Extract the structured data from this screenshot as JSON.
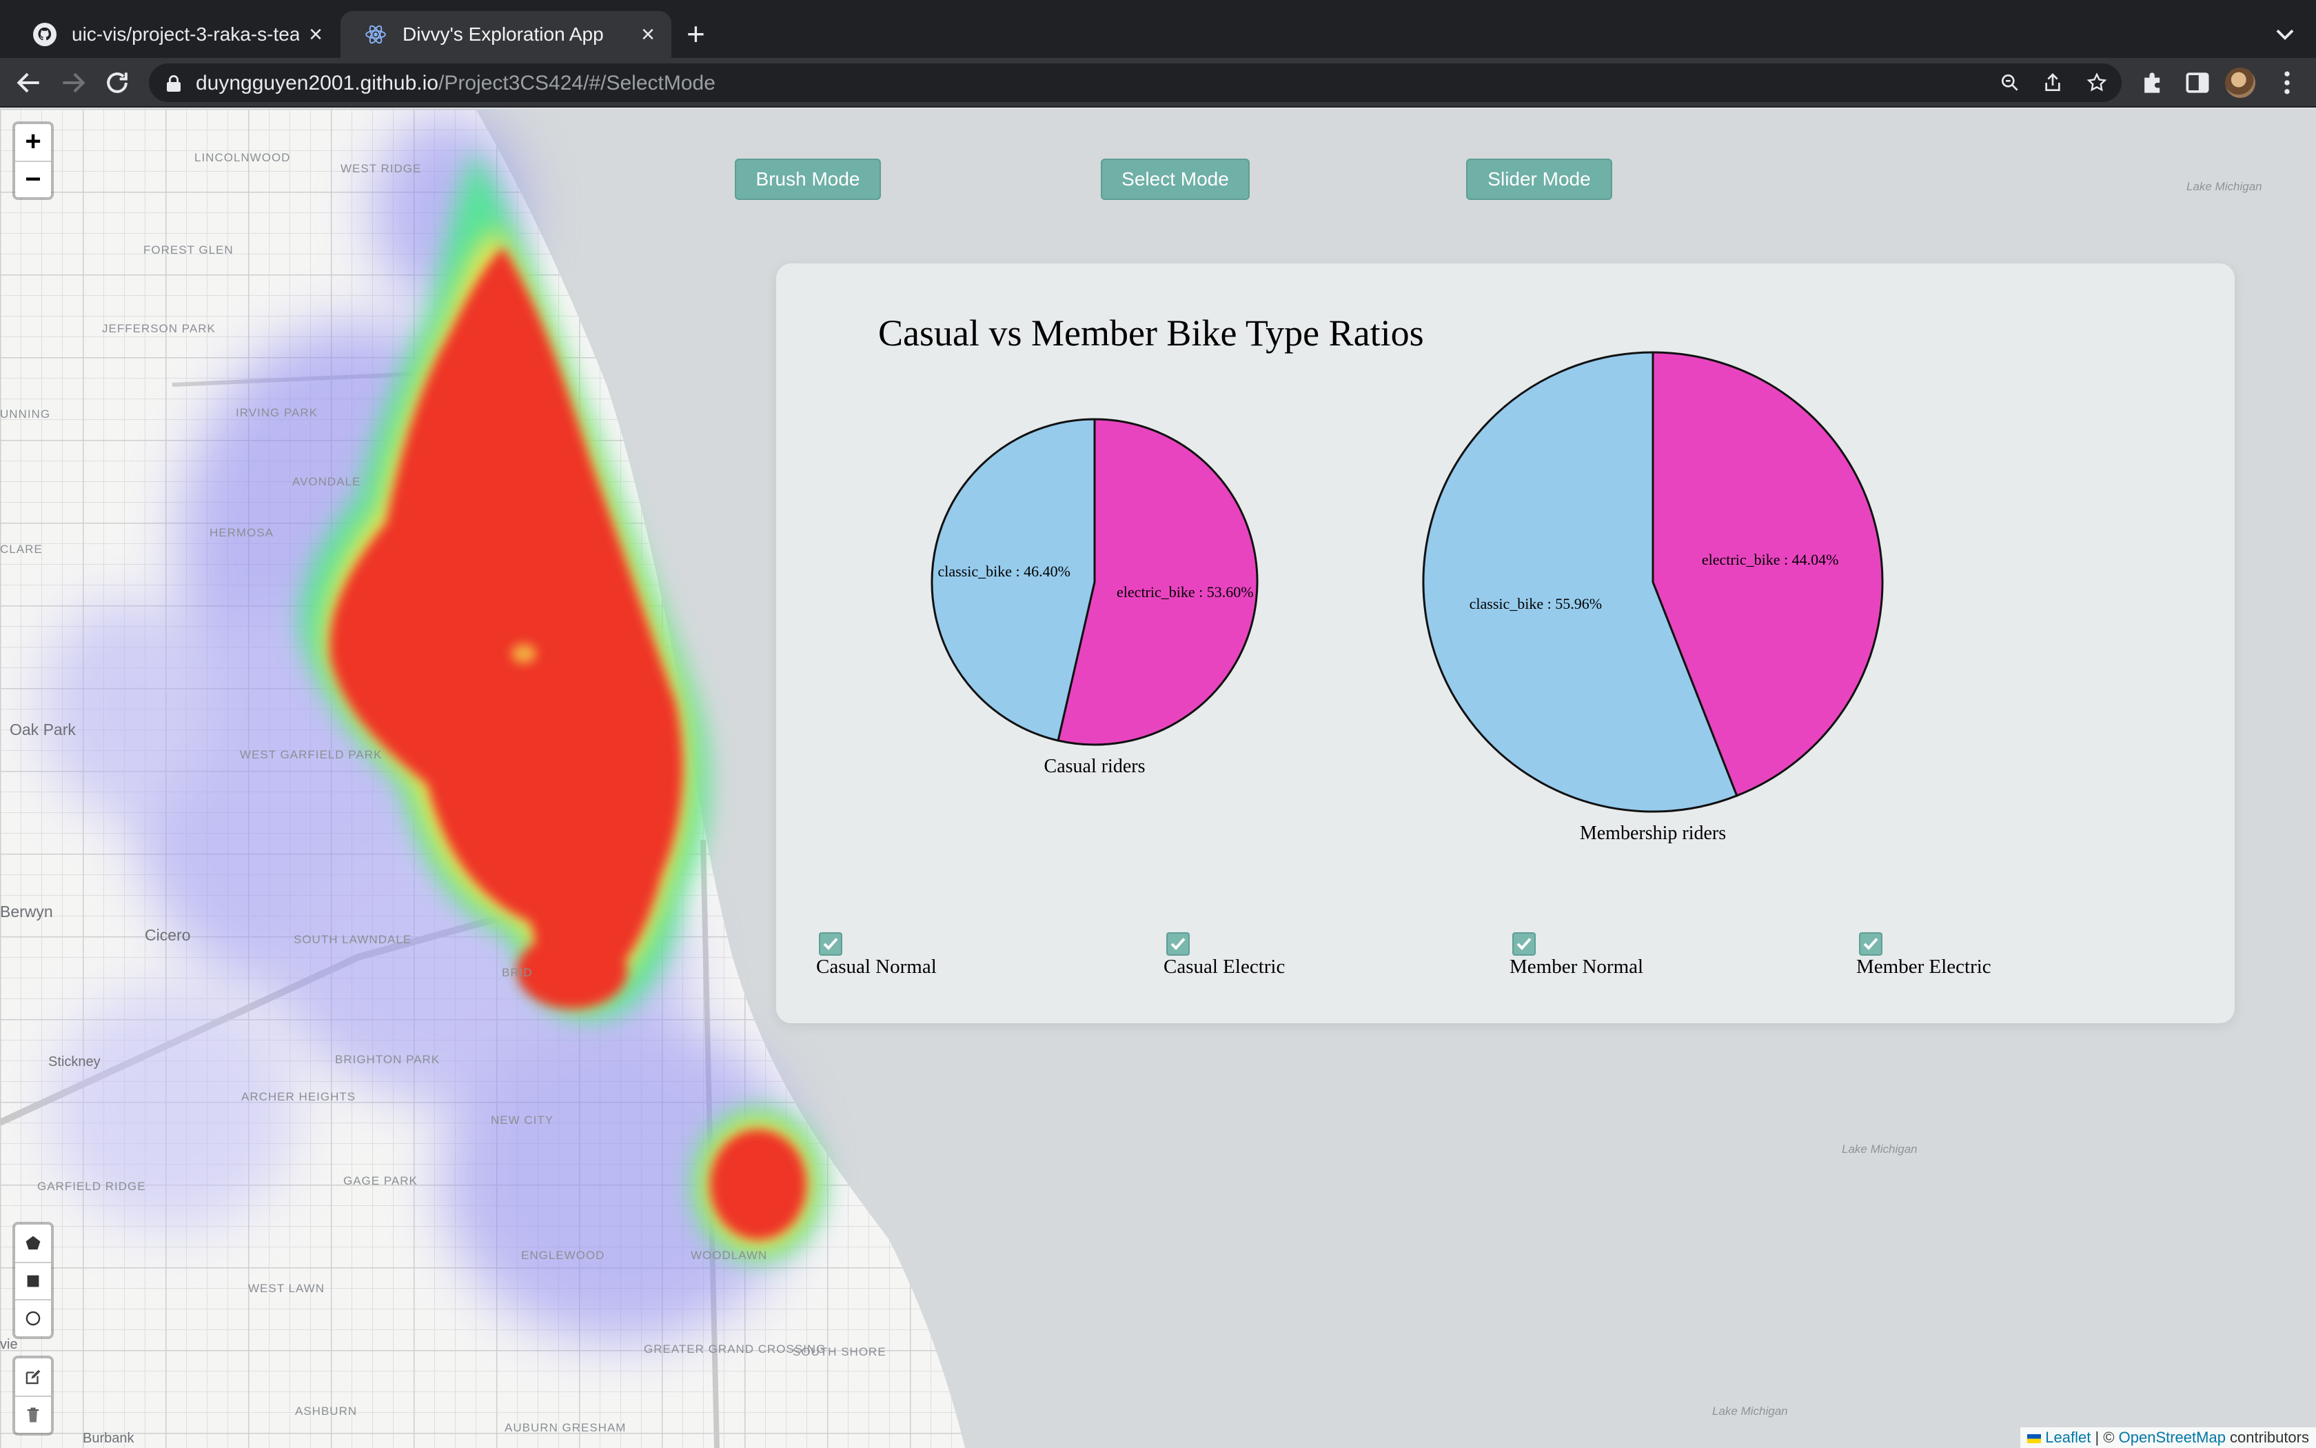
{
  "browser": {
    "tabs": [
      {
        "title": "uic-vis/project-3-raka-s-team",
        "icon": "github-icon",
        "active": false
      },
      {
        "title": "Divvy's Exploration App",
        "icon": "react-icon",
        "active": true
      }
    ],
    "new_tab_label": "+",
    "url_host": "duyngguyen2001.github.io",
    "url_path": "/Project3CS424/#/SelectMode"
  },
  "map": {
    "zoom_in": "+",
    "zoom_out": "−",
    "labels": {
      "lincolnwood": "Lincolnwood",
      "west_ridge": "West Ridge",
      "forest_glen": "Forest Glen",
      "jefferson_park": "Jefferson Park",
      "irving_park": "Irving Park",
      "avondale": "Avondale",
      "hermosa": "Hermosa",
      "running": "unning",
      "clare": "Clare",
      "oak_park": "Oak Park",
      "west_garfield_park": "West Garfield Park",
      "berwyn": "Berwyn",
      "cicero": "Cicero",
      "south_lawndale": "South Lawndale",
      "stickney": "Stickney",
      "brighton_park": "Brighton Park",
      "archer_heights": "Archer Heights",
      "new_city": "New City",
      "garfield_ridge": "Garfield Ridge",
      "gage_park": "Gage Park",
      "englewood": "Englewood",
      "woodlawn": "Woodlawn",
      "west_lawn": "West Lawn",
      "greater_grand_crossing": "Greater Grand Crossing",
      "south_shore": "South Shore",
      "ashburn": "Ashburn",
      "auburn_gresham": "Auburn Gresham",
      "burbank": "Burbank",
      "lake_michigan_1": "Lake Michigan",
      "lake_michigan_2": "Lake Michigan",
      "lake_michigan_3": "Lake Michigan",
      "partial_view": "vie",
      "bridgeport": "Brid"
    },
    "attribution": {
      "leaflet": "Leaflet",
      "sep": " | © ",
      "osm": "OpenStreetMap",
      "suffix": " contributors"
    }
  },
  "modes": {
    "brush": "Brush Mode",
    "select": "Select Mode",
    "slider": "Slider Mode"
  },
  "panel": {
    "title": "Casual vs Member Bike Type Ratios",
    "checkboxes": [
      {
        "label": "Casual Normal",
        "checked": true
      },
      {
        "label": "Casual Electric",
        "checked": true
      },
      {
        "label": "Member Normal",
        "checked": true
      },
      {
        "label": "Member Electric",
        "checked": true
      }
    ]
  },
  "chart_data": [
    {
      "type": "pie",
      "xlabel": "Casual riders",
      "slices": [
        {
          "label": "electric_bike : 53.60%",
          "category": "electric_bike",
          "value": 53.6,
          "color": "#e944c0"
        },
        {
          "label": "classic_bike : 46.40%",
          "category": "classic_bike",
          "value": 46.4,
          "color": "#96cbec"
        }
      ]
    },
    {
      "type": "pie",
      "xlabel": "Membership riders",
      "slices": [
        {
          "label": "classic_bike : 55.96%",
          "category": "classic_bike",
          "value": 55.96,
          "color": "#96cbec"
        },
        {
          "label": "electric_bike : 44.04%",
          "category": "electric_bike",
          "value": 44.04,
          "color": "#e944c0"
        }
      ]
    }
  ]
}
